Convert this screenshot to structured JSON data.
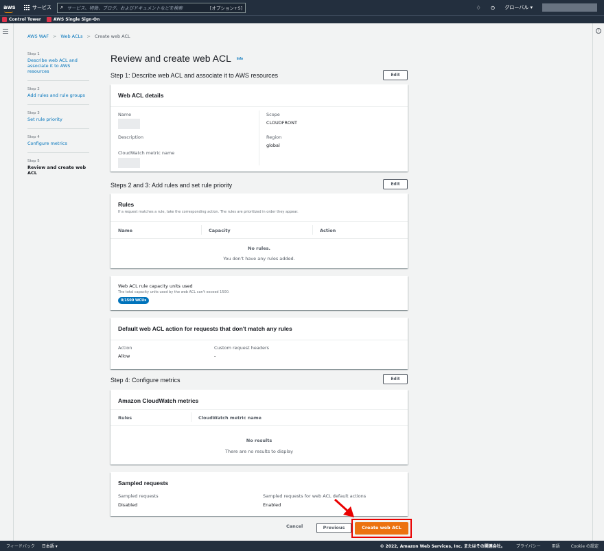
{
  "topnav": {
    "logo": "aws",
    "services": "サービス",
    "search_placeholder": "サービス、特徴、ブログ、およびドキュメントなどを検索",
    "search_shortcut": "[オプション+S]",
    "region": "グローバル ▾",
    "icons": [
      "bell-icon",
      "help-icon",
      "grid-icon",
      "search-icon"
    ]
  },
  "favorites": [
    "Control Tower",
    "AWS Single Sign-On"
  ],
  "breadcrumb": {
    "item1": "AWS WAF",
    "item2": "Web ACLs",
    "current": "Create web ACL",
    "separator": ">"
  },
  "steps": [
    {
      "num": "Step 1",
      "label": "Describe web ACL and associate it to AWS resources"
    },
    {
      "num": "Step 2",
      "label": "Add rules and rule groups"
    },
    {
      "num": "Step 3",
      "label": "Set rule priority"
    },
    {
      "num": "Step 4",
      "label": "Configure metrics"
    },
    {
      "num": "Step 5",
      "label": "Review and create web ACL"
    }
  ],
  "page": {
    "title": "Review and create web ACL",
    "info": "Info",
    "edit_label": "Edit"
  },
  "section1": {
    "head": "Step 1: Describe web ACL and associate it to AWS resources",
    "card_title": "Web ACL details",
    "name_label": "Name",
    "description_label": "Description",
    "metric_label": "CloudWatch metric name",
    "scope_label": "Scope",
    "scope_value": "CLOUDFRONT",
    "region_label": "Region",
    "region_value": "global"
  },
  "section2": {
    "head": "Steps 2 and 3: Add rules and set rule priority",
    "rules_title": "Rules",
    "rules_desc": "If a request matches a rule, take the corresponding action. The rules are prioritized in order they appear.",
    "columns": [
      "Name",
      "Capacity",
      "Action"
    ],
    "empty_title": "No rules.",
    "empty_sub": "You don't have any rules added.",
    "wcu_title": "Web ACL rule capacity units used",
    "wcu_desc": "The total capacity units used by the web ACL can't exceed 1500.",
    "wcu_badge": "0/1500 WCUs",
    "default_title": "Default web ACL action for requests that don't match any rules",
    "action_label": "Action",
    "action_value": "Allow",
    "headers_label": "Custom request headers",
    "headers_value": "-"
  },
  "section4": {
    "head": "Step 4: Configure metrics",
    "cw_title": "Amazon CloudWatch metrics",
    "columns": [
      "Rules",
      "CloudWatch metric name"
    ],
    "empty_title": "No results",
    "empty_sub": "There are no results to display",
    "sampled_title": "Sampled requests",
    "sampled_label": "Sampled requests",
    "sampled_value": "Disabled",
    "sampled_default_label": "Sampled requests for web ACL default actions",
    "sampled_default_value": "Enabled"
  },
  "footer_buttons": {
    "cancel": "Cancel",
    "previous": "Previous",
    "create": "Create web ACL"
  },
  "bottombar": {
    "feedback": "フィードバック",
    "language": "日本語 ▾",
    "copyright": "© 2022, Amazon Web Services, Inc. またはその関連会社。",
    "privacy": "プライバシー",
    "terms": "用語",
    "cookies": "Cookie の設定"
  },
  "colors": {
    "nav": "#232f3e",
    "link": "#0073bb",
    "primary": "#ec7211",
    "highlight": "#ea0000"
  }
}
